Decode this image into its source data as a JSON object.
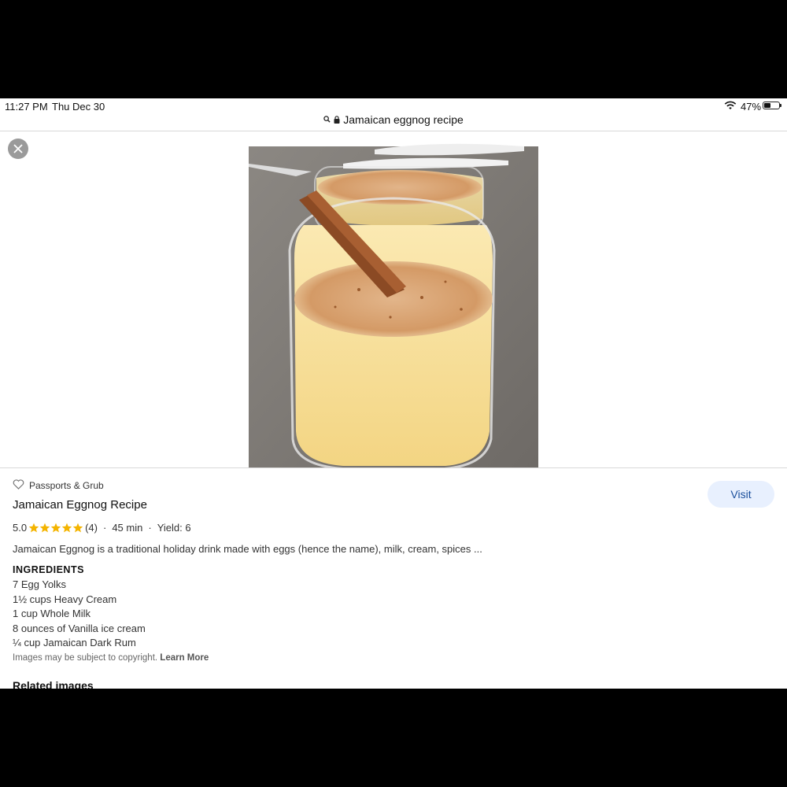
{
  "status_bar": {
    "time": "11:27 PM",
    "date": "Thu Dec 30",
    "battery_percent_label": "47%",
    "battery_level": 0.47
  },
  "url_bar": {
    "title": "Jamaican eggnog recipe",
    "icons": [
      "search-icon",
      "lock-icon"
    ]
  },
  "close_button": {
    "icon": "close-icon"
  },
  "result": {
    "source": "Passports & Grub",
    "title": "Jamaican Eggnog Recipe",
    "rating": "5.0",
    "stars": 5,
    "rating_count": "(4)",
    "separator": "·",
    "time": "45 min",
    "yield": "Yield: 6",
    "description": "Jamaican Eggnog is a traditional holiday drink made with eggs (hence the name), milk, cream, spices ...",
    "visit_label": "Visit",
    "star_color": "#f4b400",
    "accent_color": "#1a4f9c"
  },
  "ingredients": {
    "heading": "INGREDIENTS",
    "items": [
      "7 Egg Yolks",
      "1½ cups Heavy Cream",
      "1 cup Whole Milk",
      "8 ounces of Vanilla ice cream",
      "¼ cup Jamaican Dark Rum"
    ]
  },
  "copyright": {
    "text": "Images may be subject to copyright.",
    "link": "Learn More"
  },
  "related_heading": "Related images"
}
